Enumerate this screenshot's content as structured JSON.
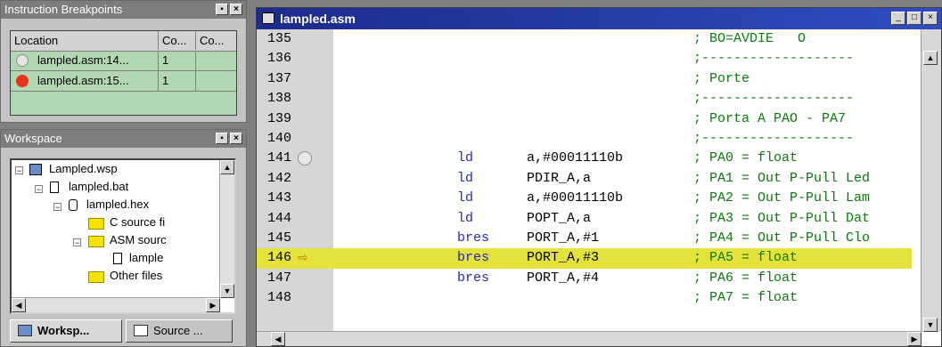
{
  "breakpoints": {
    "title": "Instruction Breakpoints",
    "columns": [
      "Location",
      "Co...",
      "Co..."
    ],
    "rows": [
      {
        "location": "lampled.asm:14...",
        "count": "1",
        "state": "disabled"
      },
      {
        "location": "lampled.asm:15...",
        "count": "1",
        "state": "enabled"
      }
    ]
  },
  "workspace": {
    "title": "Workspace",
    "tree": [
      {
        "label": "Lampled.wsp",
        "icon": "workspace-icon"
      },
      {
        "label": "lampled.bat",
        "icon": "document-icon"
      },
      {
        "label": "lampled.hex",
        "icon": "hex-file-icon"
      },
      {
        "label": "C source fi",
        "icon": "folder-icon"
      },
      {
        "label": "ASM sourc",
        "icon": "folder-icon"
      },
      {
        "label": "lample",
        "icon": "document-icon"
      },
      {
        "label": "Other files",
        "icon": "folder-icon"
      }
    ],
    "tabs": [
      "Worksp...",
      "Source ..."
    ]
  },
  "editor": {
    "title": "lampled.asm",
    "lines": [
      {
        "n": "135",
        "op": "",
        "arg": "",
        "comment": "; BO=AVDIE   O"
      },
      {
        "n": "136",
        "op": "",
        "arg": "",
        "comment": ";-------------------"
      },
      {
        "n": "137",
        "op": "",
        "arg": "",
        "comment": "; Porte"
      },
      {
        "n": "138",
        "op": "",
        "arg": "",
        "comment": ";-------------------"
      },
      {
        "n": "139",
        "op": "",
        "arg": "",
        "comment": "; Porta A PAO - PA7"
      },
      {
        "n": "140",
        "op": "",
        "arg": "",
        "comment": ";-------------------"
      },
      {
        "n": "141",
        "op": "ld",
        "arg": "a,#00011110b",
        "comment": "; PA0 = float"
      },
      {
        "n": "142",
        "op": "ld",
        "arg": "PDIR_A,a",
        "comment": "; PA1 = Out P-Pull Led"
      },
      {
        "n": "143",
        "op": "ld",
        "arg": "a,#00011110b",
        "comment": "; PA2 = Out P-Pull Lam"
      },
      {
        "n": "144",
        "op": "ld",
        "arg": "POPT_A,a",
        "comment": "; PA3 = Out P-Pull Dat"
      },
      {
        "n": "145",
        "op": "bres",
        "arg": "PORT_A,#1",
        "comment": "; PA4 = Out P-Pull Clo"
      },
      {
        "n": "146",
        "op": "bres",
        "arg": "PORT_A,#3",
        "comment": "; PA5 = float"
      },
      {
        "n": "147",
        "op": "bres",
        "arg": "PORT_A,#4",
        "comment": "; PA6 = float"
      },
      {
        "n": "148",
        "op": "",
        "arg": "",
        "comment": "; PA7 = float"
      }
    ],
    "current_line": "146",
    "breakpoint_line": "141"
  },
  "colors": {
    "highlight": "#e3e33c",
    "opcode": "#2a2ab0",
    "comment": "#0a7a0a",
    "breakpoint_enabled": "#e8321e"
  }
}
